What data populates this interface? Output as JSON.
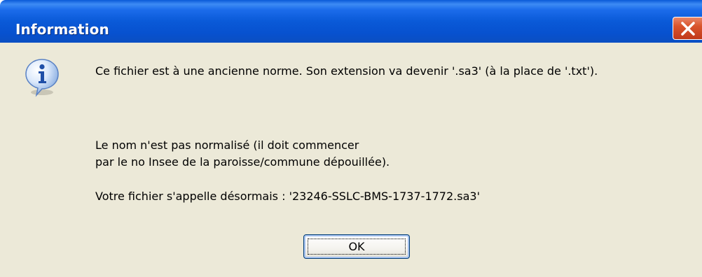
{
  "window": {
    "title": "Information"
  },
  "icons": {
    "close": "close-icon",
    "info": "information-icon"
  },
  "colors": {
    "titlebar": "#0a5ad8",
    "client_background": "#ece9d8",
    "close_button": "#d9542c"
  },
  "message": {
    "line1": "Ce fichier est à une ancienne norme. Son extension va devenir '.sa3' (à la place de '.txt').",
    "line2": "Le nom n'est pas normalisé (il doit commencer",
    "line3": "par le no Insee de la paroisse/commune dépouillée).",
    "line4": "Votre fichier s'appelle désormais : '23246-SSLC-BMS-1737-1772.sa3'"
  },
  "buttons": {
    "ok_label": "OK"
  }
}
